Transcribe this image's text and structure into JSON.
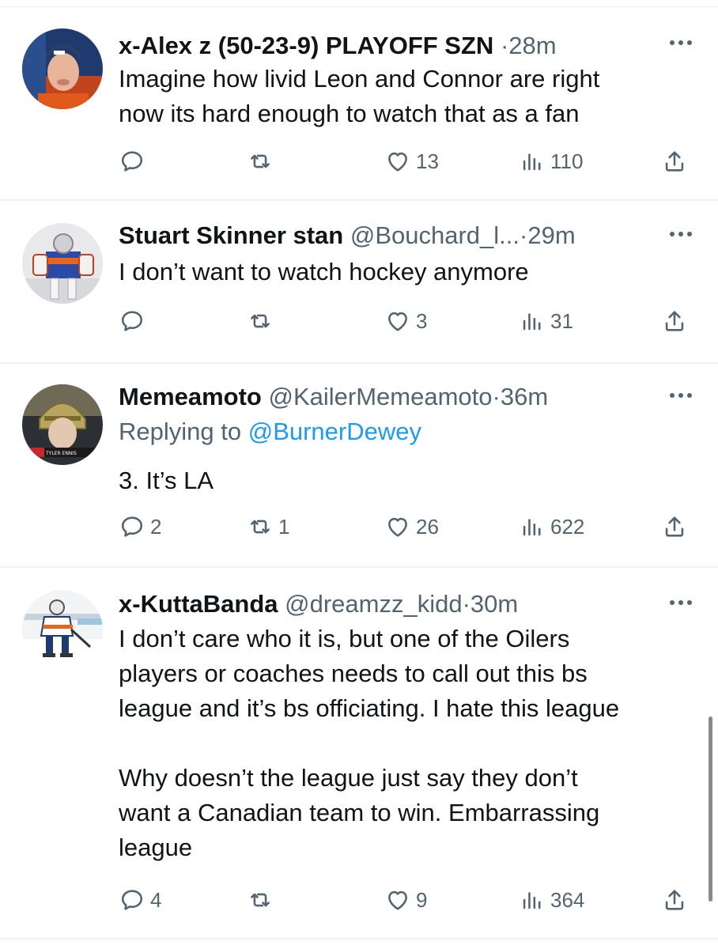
{
  "tweets": [
    {
      "display_name": "x-Alex z (50-23-9) PLAYOFF SZN",
      "handle": "",
      "dot": "·",
      "time": "28m",
      "replying_to_label": "",
      "replying_to_user": "",
      "text": "Imagine how livid Leon and Connor are right\nnow its hard enough to watch that as a fan",
      "replies": "",
      "retweets": "",
      "likes": "13",
      "views": "110"
    },
    {
      "display_name": "Stuart Skinner stan",
      "handle": "@Bouchard_l...",
      "dot": "·",
      "time": "29m",
      "replying_to_label": "",
      "replying_to_user": "",
      "text": "I don’t want to watch hockey anymore",
      "replies": "",
      "retweets": "",
      "likes": "3",
      "views": "31"
    },
    {
      "display_name": "Memeamoto",
      "handle": "@KailerMemeamoto",
      "dot": "·",
      "time": "36m",
      "replying_to_label": "Replying to",
      "replying_to_user": "@BurnerDewey",
      "text": "3. It’s LA",
      "replies": "2",
      "retweets": "1",
      "likes": "26",
      "views": "622"
    },
    {
      "display_name": "x-KuttaBanda",
      "handle": "@dreamzz_kidd",
      "dot": "·",
      "time": "30m",
      "replying_to_label": "",
      "replying_to_user": "",
      "text": "I don’t care who it is, but one of the Oilers\nplayers or coaches needs to call out this bs\nleague and it’s bs officiating. I hate this league\n\nWhy doesn’t the league just say they don’t\nwant a Canadian team to win. Embarrassing\nleague",
      "replies": "4",
      "retweets": "",
      "likes": "9",
      "views": "364"
    }
  ],
  "avatar_caption": "TYLER ENNIS",
  "colors": {
    "text": "#0f1419",
    "secondary": "#536471",
    "link": "#1d9bf0",
    "divider": "#eff3f4"
  },
  "icons": [
    "reply-icon",
    "retweet-icon",
    "like-icon",
    "views-icon",
    "share-icon",
    "more-icon"
  ]
}
